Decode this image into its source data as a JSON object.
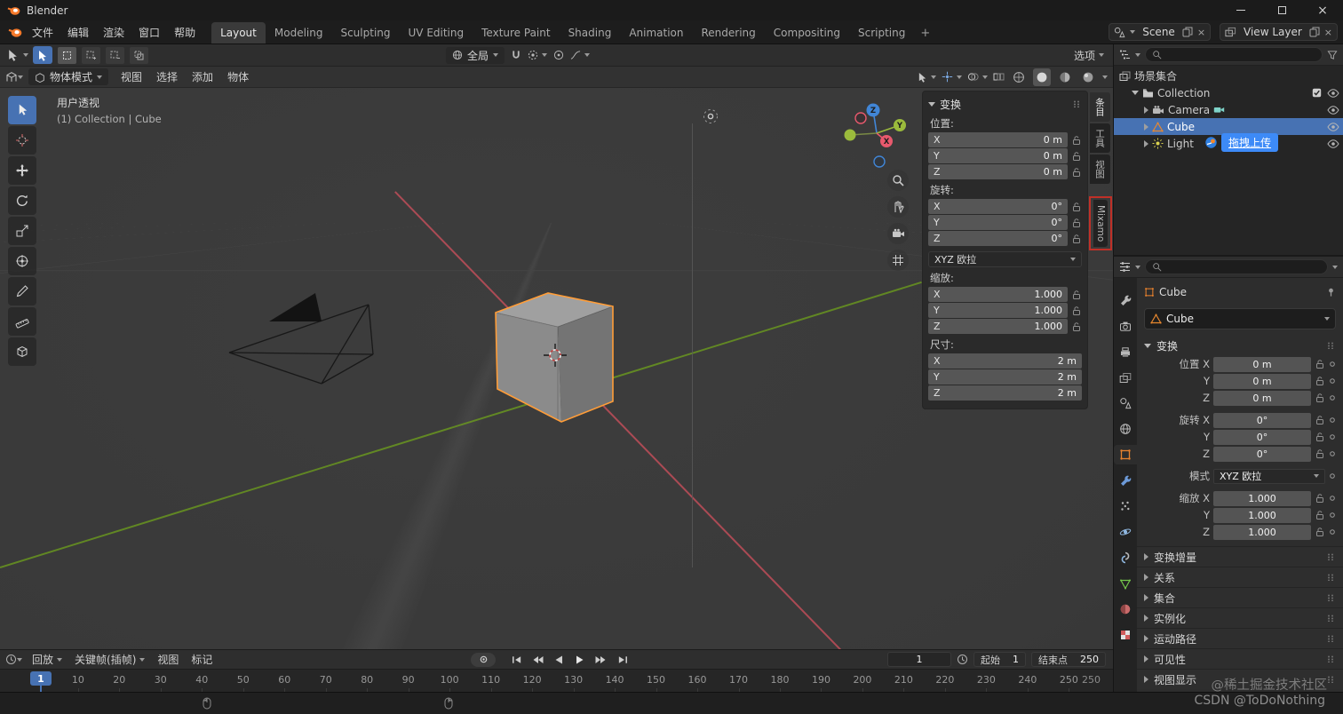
{
  "titlebar": {
    "title": "Blender"
  },
  "topbar": {
    "menus": [
      "文件",
      "编辑",
      "渲染",
      "窗口",
      "帮助"
    ],
    "workspaces": [
      "Layout",
      "Modeling",
      "Sculpting",
      "UV Editing",
      "Texture Paint",
      "Shading",
      "Animation",
      "Rendering",
      "Compositing",
      "Scripting"
    ],
    "active_workspace": "Layout",
    "add_tab": "+",
    "scene": {
      "label": "Scene"
    },
    "view_layer": {
      "label": "View Layer"
    }
  },
  "tool_header": {
    "orientation": "全局",
    "options": "选项"
  },
  "viewport_header": {
    "mode": "物体模式",
    "menus": [
      "视图",
      "选择",
      "添加",
      "物体"
    ]
  },
  "toolbar": {
    "tools": [
      "select-box",
      "cursor",
      "move",
      "rotate",
      "scale",
      "transform",
      "annotate",
      "measure",
      "add-cube"
    ],
    "active_tool": "select-box"
  },
  "viewport": {
    "view_label": "用户透视",
    "context_label": "(1) Collection | Cube",
    "gizmo": {
      "x": "X",
      "y": "Y",
      "z": "Z"
    },
    "nav_icons": [
      "zoom",
      "pan",
      "camera-view",
      "perspective-toggle"
    ]
  },
  "npanel": {
    "header": "变换",
    "groups": {
      "location": {
        "label": "位置:",
        "locks": true,
        "rows": [
          {
            "axis": "X",
            "value": "0 m"
          },
          {
            "axis": "Y",
            "value": "0 m"
          },
          {
            "axis": "Z",
            "value": "0 m"
          }
        ]
      },
      "rotation": {
        "label": "旋转:",
        "locks": true,
        "rows": [
          {
            "axis": "X",
            "value": "0°"
          },
          {
            "axis": "Y",
            "value": "0°"
          },
          {
            "axis": "Z",
            "value": "0°"
          }
        ]
      },
      "scale": {
        "label": "缩放:",
        "locks": true,
        "rows": [
          {
            "axis": "X",
            "value": "1.000"
          },
          {
            "axis": "Y",
            "value": "1.000"
          },
          {
            "axis": "Z",
            "value": "1.000"
          }
        ]
      },
      "dimensions": {
        "label": "尺寸:",
        "locks": false,
        "rows": [
          {
            "axis": "X",
            "value": "2 m"
          },
          {
            "axis": "Y",
            "value": "2 m"
          },
          {
            "axis": "Z",
            "value": "2 m"
          }
        ]
      }
    },
    "rotation_mode": "XYZ 欧拉",
    "side_tabs": [
      "条目",
      "工具",
      "视图"
    ],
    "active_side_tab": "条目",
    "plugin_tab": "Mixamo"
  },
  "outliner": {
    "rows": [
      {
        "label": "场景集合",
        "icon": "scene-collection",
        "indent": 0
      },
      {
        "label": "Collection",
        "icon": "collection",
        "indent": 1,
        "arrow": "down",
        "checkbox": true,
        "eye": true
      },
      {
        "label": "Camera",
        "icon": "camera",
        "indent": 2,
        "arrow": "right",
        "badge": "camera-data",
        "eye": true
      },
      {
        "label": "Cube",
        "icon": "mesh",
        "indent": 2,
        "arrow": "right",
        "selected": true,
        "eye": true
      },
      {
        "label": "Light",
        "icon": "light",
        "indent": 2,
        "arrow": "right",
        "eye": true
      }
    ],
    "overlay_chip": "拖拽上传"
  },
  "properties": {
    "breadcrumb": "Cube",
    "name": "Cube",
    "transform_header": "变换",
    "transform_groups": [
      {
        "rows": [
          {
            "label": "位置 X",
            "value": "0 m",
            "lock": true
          },
          {
            "label": "Y",
            "value": "0 m",
            "lock": true
          },
          {
            "label": "Z",
            "value": "0 m",
            "lock": true
          }
        ]
      },
      {
        "rows": [
          {
            "label": "旋转 X",
            "value": "0°",
            "lock": true
          },
          {
            "label": "Y",
            "value": "0°",
            "lock": true
          },
          {
            "label": "Z",
            "value": "0°",
            "lock": true
          }
        ]
      },
      {
        "rows": [
          {
            "label": "模式",
            "value": "XYZ 欧拉",
            "type": "dropdown"
          }
        ]
      },
      {
        "rows": [
          {
            "label": "缩放 X",
            "value": "1.000",
            "lock": true
          },
          {
            "label": "Y",
            "value": "1.000",
            "lock": true
          },
          {
            "label": "Z",
            "value": "1.000",
            "lock": true
          }
        ]
      }
    ],
    "collapsed_sections": [
      "变换增量",
      "关系",
      "集合",
      "实例化",
      "运动路径",
      "可见性",
      "视图显示"
    ],
    "tabs": [
      "tool",
      "render",
      "output",
      "view-layer",
      "scene",
      "world",
      "object",
      "modifiers",
      "particles",
      "physics",
      "constraints",
      "object-data",
      "material",
      "texture"
    ],
    "active_tab": "object"
  },
  "timeline": {
    "menus": [
      {
        "label": "回放",
        "dropdown": true
      },
      {
        "label": "关键帧(插帧)",
        "dropdown": true
      },
      {
        "label": "视图",
        "dropdown": false
      },
      {
        "label": "标记",
        "dropdown": false
      }
    ],
    "playback": [
      "jump-start",
      "prev-keyframe",
      "play-reverse",
      "play",
      "next-keyframe",
      "jump-end"
    ],
    "current_frame": "1",
    "start": {
      "label": "起始",
      "value": "1"
    },
    "end": {
      "label": "结束点",
      "value": "250"
    },
    "playhead": "1",
    "ruler_ticks": [
      10,
      20,
      30,
      40,
      50,
      60,
      70,
      80,
      90,
      100,
      110,
      120,
      130,
      140,
      150,
      160,
      170,
      180,
      190,
      200,
      210,
      220,
      230,
      240,
      250
    ],
    "end_marker": "250"
  },
  "watermarks": {
    "line1": "@稀土掘金技术社区",
    "line2": "CSDN @ToDoNothing"
  },
  "colors": {
    "accent": "#4772b3",
    "object_orange": "#ff9d38",
    "axis_x": "#c84f5b",
    "axis_y": "#6fa21c",
    "overlay_blue": "#3d8af7",
    "annotation_red": "#c03028"
  }
}
